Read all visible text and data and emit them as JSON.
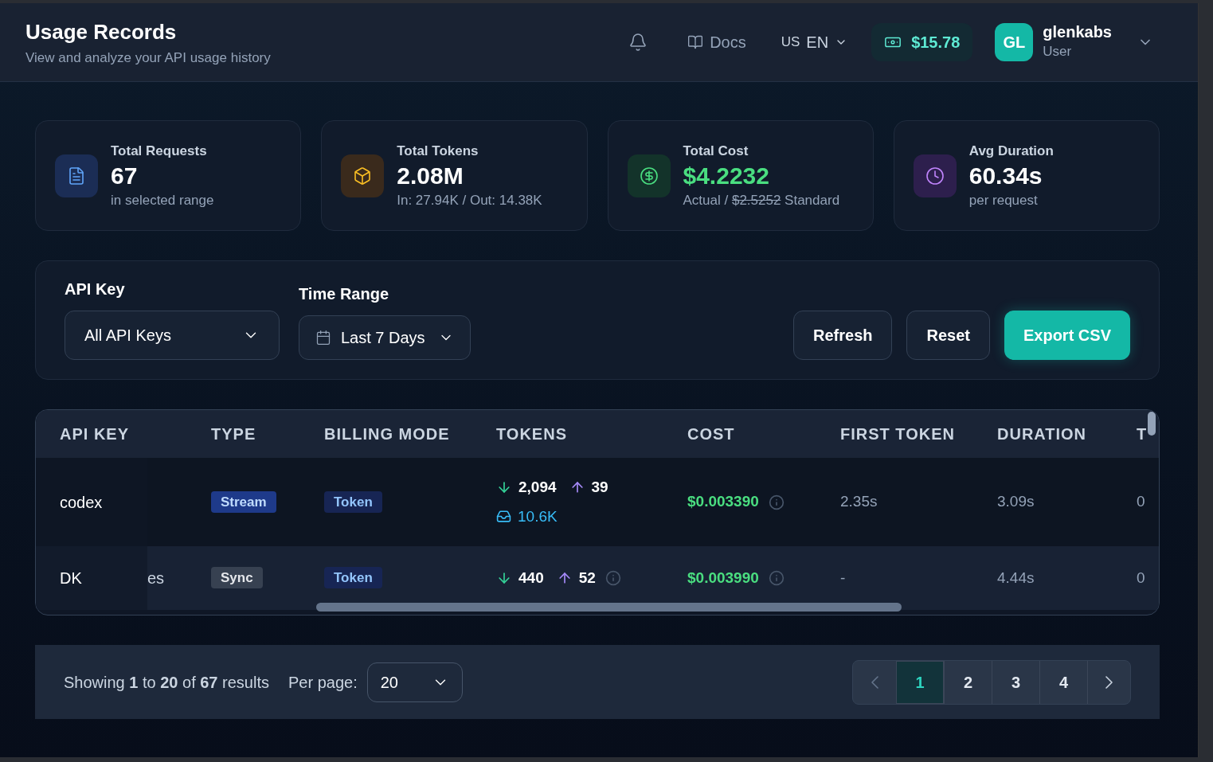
{
  "header": {
    "title": "Usage Records",
    "subtitle": "View and analyze your API usage history",
    "docs": "Docs",
    "language": {
      "flag": "US",
      "code": "EN"
    },
    "balance": "$15.78",
    "user": {
      "initials": "GL",
      "name": "glenkabs",
      "role": "User"
    }
  },
  "stats": [
    {
      "kind": "requests",
      "label": "Total Requests",
      "value": "67",
      "note": "in selected range"
    },
    {
      "kind": "tokens",
      "label": "Total Tokens",
      "value": "2.08M",
      "note": "In: 27.94K / Out: 14.38K"
    },
    {
      "kind": "cost",
      "label": "Total Cost",
      "value": "$4.2232",
      "note_prefix": "Actual / ",
      "note_struck": "$2.5252",
      "note_suffix": " Standard"
    },
    {
      "kind": "duration",
      "label": "Avg Duration",
      "value": "60.34s",
      "note": "per request"
    }
  ],
  "filters": {
    "api_key": {
      "label": "API Key",
      "value": "All API Keys"
    },
    "time_range": {
      "label": "Time Range",
      "value": "Last 7 Days"
    },
    "buttons": [
      {
        "kind": "plain",
        "label": "Refresh"
      },
      {
        "kind": "plain",
        "label": "Reset"
      },
      {
        "kind": "primary",
        "label": "Export CSV"
      }
    ]
  },
  "table": {
    "columns": [
      "API KEY",
      "TYPE",
      "BILLING MODE",
      "TOKENS",
      "COST",
      "FIRST TOKEN",
      "DURATION",
      "T"
    ],
    "rows": [
      {
        "api_key": "codex",
        "column_2": "",
        "type": {
          "kind": "stream",
          "label": "Stream"
        },
        "billing": "Token",
        "tokens_in": "2,094",
        "tokens_out": "39",
        "cache": "10.6K",
        "cost": "$0.003390",
        "first_token": "2.35s",
        "duration": "3.09s",
        "column_9": "0"
      },
      {
        "api_key": "DK",
        "column_2": "es",
        "type": {
          "kind": "sync",
          "label": "Sync"
        },
        "billing": "Token",
        "tokens_in": "440",
        "tokens_out": "52",
        "cache": "",
        "cost": "$0.003990",
        "first_token": "-",
        "duration": "4.44s",
        "column_9": "0"
      }
    ]
  },
  "pagination": {
    "summary": "Showing **1** to **20** of **67** results",
    "per_page_label": "Per page:",
    "per_page": "20",
    "pages": [
      {
        "label": "1",
        "selected": true
      },
      {
        "label": "2",
        "selected": false
      },
      {
        "label": "3",
        "selected": false
      },
      {
        "label": "4",
        "selected": false
      }
    ]
  }
}
